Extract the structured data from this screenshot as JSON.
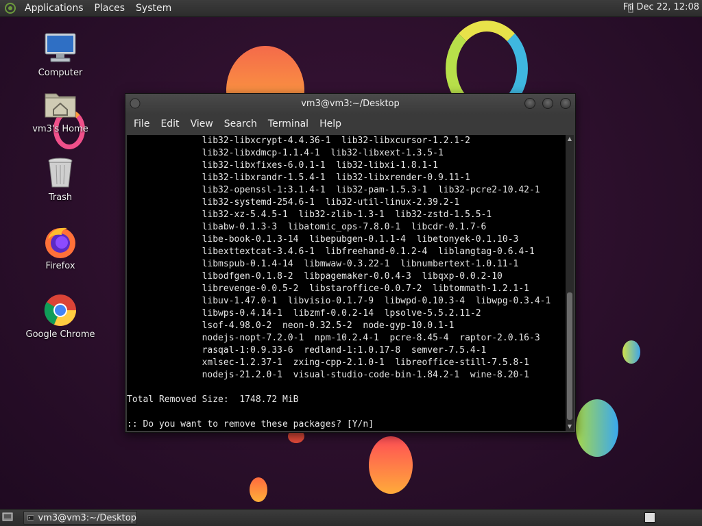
{
  "top_panel": {
    "menus": [
      "Applications",
      "Places",
      "System"
    ],
    "clock": "Fri Dec 22, 12:08"
  },
  "desktop": {
    "icons": [
      {
        "label": "Computer",
        "icon": "computer-icon"
      },
      {
        "label": "vm3's Home",
        "icon": "home-folder-icon"
      },
      {
        "label": "Trash",
        "icon": "trash-icon"
      },
      {
        "label": "Firefox",
        "icon": "firefox-icon"
      },
      {
        "label": "Google Chrome",
        "icon": "chrome-icon"
      }
    ]
  },
  "terminal": {
    "title": "vm3@vm3:~/Desktop",
    "menu": [
      "File",
      "Edit",
      "View",
      "Search",
      "Terminal",
      "Help"
    ],
    "lines": [
      "              lib32-libxcrypt-4.4.36-1  lib32-libxcursor-1.2.1-2",
      "              lib32-libxdmcp-1.1.4-1  lib32-libxext-1.3.5-1",
      "              lib32-libxfixes-6.0.1-1  lib32-libxi-1.8.1-1",
      "              lib32-libxrandr-1.5.4-1  lib32-libxrender-0.9.11-1",
      "              lib32-openssl-1:3.1.4-1  lib32-pam-1.5.3-1  lib32-pcre2-10.42-1",
      "              lib32-systemd-254.6-1  lib32-util-linux-2.39.2-1",
      "              lib32-xz-5.4.5-1  lib32-zlib-1.3-1  lib32-zstd-1.5.5-1",
      "              libabw-0.1.3-3  libatomic_ops-7.8.0-1  libcdr-0.1.7-6",
      "              libe-book-0.1.3-14  libepubgen-0.1.1-4  libetonyek-0.1.10-3",
      "              libexttextcat-3.4.6-1  libfreehand-0.1.2-4  liblangtag-0.6.4-1",
      "              libmspub-0.1.4-14  libmwaw-0.3.22-1  libnumbertext-1.0.11-1",
      "              libodfgen-0.1.8-2  libpagemaker-0.0.4-3  libqxp-0.0.2-10",
      "              librevenge-0.0.5-2  libstaroffice-0.0.7-2  libtommath-1.2.1-1",
      "              libuv-1.47.0-1  libvisio-0.1.7-9  libwpd-0.10.3-4  libwpg-0.3.4-1",
      "              libwps-0.4.14-1  libzmf-0.0.2-14  lpsolve-5.5.2.11-2",
      "              lsof-4.98.0-2  neon-0.32.5-2  node-gyp-10.0.1-1",
      "              nodejs-nopt-7.2.0-1  npm-10.2.4-1  pcre-8.45-4  raptor-2.0.16-3",
      "              rasqal-1:0.9.33-6  redland-1:1.0.17-8  semver-7.5.4-1",
      "              xmlsec-1.2.37-1  zxing-cpp-2.1.0-1  libreoffice-still-7.5.8-1",
      "              nodejs-21.2.0-1  visual-studio-code-bin-1.84.2-1  wine-8.20-1",
      "",
      "Total Removed Size:  1748.72 MiB",
      "",
      ":: Do you want to remove these packages? [Y/n]"
    ]
  },
  "taskbar": {
    "task_label": "vm3@vm3:~/Desktop"
  },
  "colors": {
    "desktop_bg": "#2b0f2b",
    "panel_bg": "#333333",
    "terminal_bg": "#000000",
    "terminal_fg": "#e6e6e6"
  }
}
